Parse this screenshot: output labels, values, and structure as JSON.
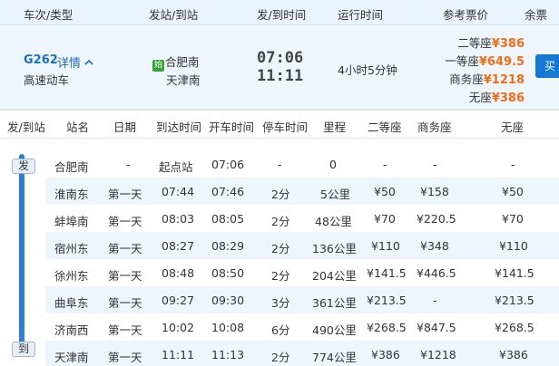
{
  "header": {
    "train_type": "车次/类型",
    "stations": "发站/到站",
    "times": "发/到时间",
    "duration": "运行时间",
    "price": "参考票价",
    "extra": "余票"
  },
  "train": {
    "code": "G262",
    "detail_label": "详情",
    "detail_icon": "chevron-up-icon",
    "type": "高速动车",
    "start_badge": "始",
    "from_station": "合肥南",
    "to_station": "天津南",
    "depart_time": "07:06",
    "arrive_time": "11:11",
    "duration": "4小时5分钟",
    "prices": [
      {
        "label": "二等座",
        "value": "¥386"
      },
      {
        "label": "一等座",
        "value": "¥649.5"
      },
      {
        "label": "商务座",
        "value": "¥1218"
      },
      {
        "label": "无座",
        "value": "¥386"
      }
    ],
    "buy_label": "买"
  },
  "columns": [
    "发/到站",
    "站名",
    "日期",
    "到达时间",
    "开车时间",
    "停车时间",
    "里程",
    "二等座",
    "商务座",
    "无座"
  ],
  "markers": {
    "depart": "发",
    "arrive": "到"
  },
  "stops": [
    {
      "name": "合肥南",
      "day": "-",
      "arrive": "起点站",
      "depart": "07:06",
      "stop": "-",
      "mileage": "0",
      "second": "-",
      "business": "-",
      "nosit": "-"
    },
    {
      "name": "淮南东",
      "day": "第一天",
      "arrive": "07:44",
      "depart": "07:46",
      "stop": "2分",
      "mileage": "5公里",
      "second": "¥50",
      "business": "¥158",
      "nosit": "¥50"
    },
    {
      "name": "蚌埠南",
      "day": "第一天",
      "arrive": "08:03",
      "depart": "08:05",
      "stop": "2分",
      "mileage": "48公里",
      "second": "¥70",
      "business": "¥220.5",
      "nosit": "¥70"
    },
    {
      "name": "宿州东",
      "day": "第一天",
      "arrive": "08:27",
      "depart": "08:29",
      "stop": "2分",
      "mileage": "136公里",
      "second": "¥110",
      "business": "¥348",
      "nosit": "¥110"
    },
    {
      "name": "徐州东",
      "day": "第一天",
      "arrive": "08:48",
      "depart": "08:50",
      "stop": "2分",
      "mileage": "204公里",
      "second": "¥141.5",
      "business": "¥446.5",
      "nosit": "¥141.5"
    },
    {
      "name": "曲阜东",
      "day": "第一天",
      "arrive": "09:27",
      "depart": "09:30",
      "stop": "3分",
      "mileage": "361公里",
      "second": "¥213.5",
      "business": "-",
      "nosit": "¥213.5"
    },
    {
      "name": "济南西",
      "day": "第一天",
      "arrive": "10:02",
      "depart": "10:08",
      "stop": "6分",
      "mileage": "490公里",
      "second": "¥268.5",
      "business": "¥847.5",
      "nosit": "¥268.5"
    },
    {
      "name": "天津南",
      "day": "第一天",
      "arrive": "11:11",
      "depart": "11:13",
      "stop": "2分",
      "mileage": "774公里",
      "second": "¥386",
      "business": "¥1218",
      "nosit": "¥386"
    }
  ]
}
